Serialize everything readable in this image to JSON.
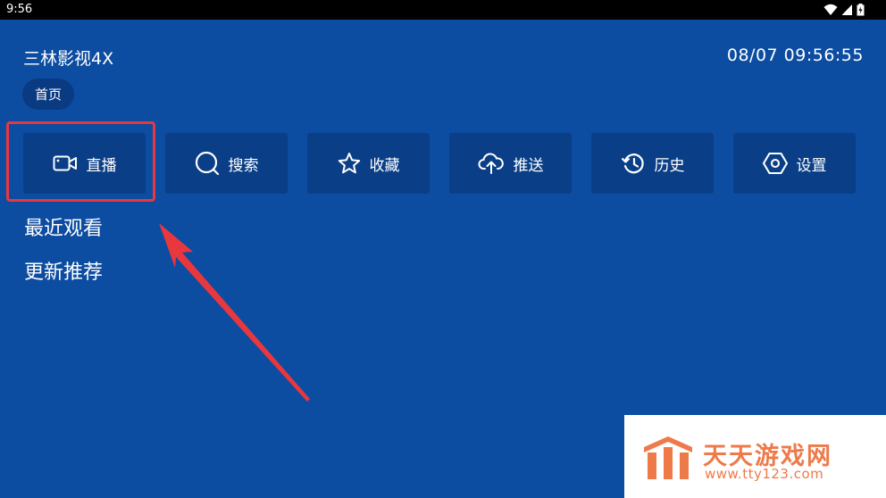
{
  "status_bar": {
    "time": "9:56"
  },
  "header": {
    "app_title": "三林影视4X",
    "datetime": "08/07 09:56:55"
  },
  "tabs": [
    {
      "label": "首页"
    }
  ],
  "tiles": [
    {
      "label": "直播",
      "icon": "video-camera-icon"
    },
    {
      "label": "搜索",
      "icon": "search-icon"
    },
    {
      "label": "收藏",
      "icon": "star-icon"
    },
    {
      "label": "推送",
      "icon": "cloud-upload-icon"
    },
    {
      "label": "历史",
      "icon": "history-icon"
    },
    {
      "label": "设置",
      "icon": "hexagon-settings-icon"
    }
  ],
  "sections": {
    "recent": "最近观看",
    "recommend": "更新推荐"
  },
  "annotation": {
    "highlight_color": "#e9373e"
  },
  "watermark": {
    "name": "天天游戏网",
    "url": "www.tty123.com"
  },
  "colors": {
    "background": "#0c4ca1",
    "tile": "#0a3f87",
    "accent": "#ee7a4a"
  }
}
